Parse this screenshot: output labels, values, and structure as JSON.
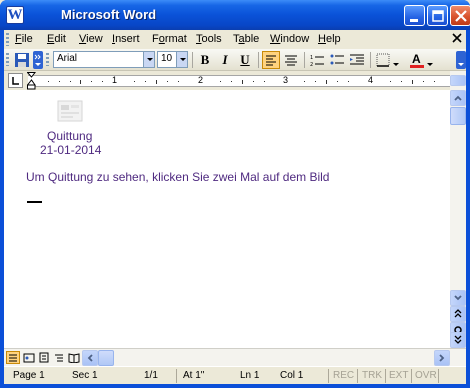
{
  "window": {
    "title": "Microsoft Word",
    "icon": "word-icon"
  },
  "menu": {
    "items": [
      {
        "label": "File",
        "ul": "F",
        "rest": "ile"
      },
      {
        "label": "Edit",
        "ul": "E",
        "rest": "dit"
      },
      {
        "label": "View",
        "ul": "V",
        "rest": "iew"
      },
      {
        "label": "Insert",
        "ul": "I",
        "rest": "nsert"
      },
      {
        "label": "Format",
        "ul": "o",
        "pre": "F",
        "rest": "rmat"
      },
      {
        "label": "Tools",
        "ul": "T",
        "rest": "ools"
      },
      {
        "label": "Table",
        "ul": "a",
        "pre": "T",
        "rest": "ble"
      },
      {
        "label": "Window",
        "ul": "W",
        "rest": "indow"
      },
      {
        "label": "Help",
        "ul": "H",
        "rest": "elp"
      }
    ]
  },
  "toolbar": {
    "font_name": "Arial",
    "font_size": "10",
    "bold_label": "B",
    "italic_label": "I",
    "underline_label": "U",
    "align_left_active": true,
    "accent_color": "#ffd37e",
    "font_color": "#e02020"
  },
  "ruler": {
    "numbers": [
      "1",
      "2",
      "3",
      "4"
    ]
  },
  "document": {
    "image_caption": "Quittung",
    "image_date": "21-01-2014",
    "instruction": "Um Quittung zu sehen, klicken Sie zwei Mal auf dem Bild",
    "text_color": "#4f2a80"
  },
  "status": {
    "page": "Page  1",
    "section": "Sec  1",
    "page_of": "1/1",
    "at": "At  1\"",
    "line": "Ln  1",
    "col": "Col  1",
    "rec": "REC",
    "trk": "TRK",
    "ext": "EXT",
    "ovr": "OVR"
  }
}
